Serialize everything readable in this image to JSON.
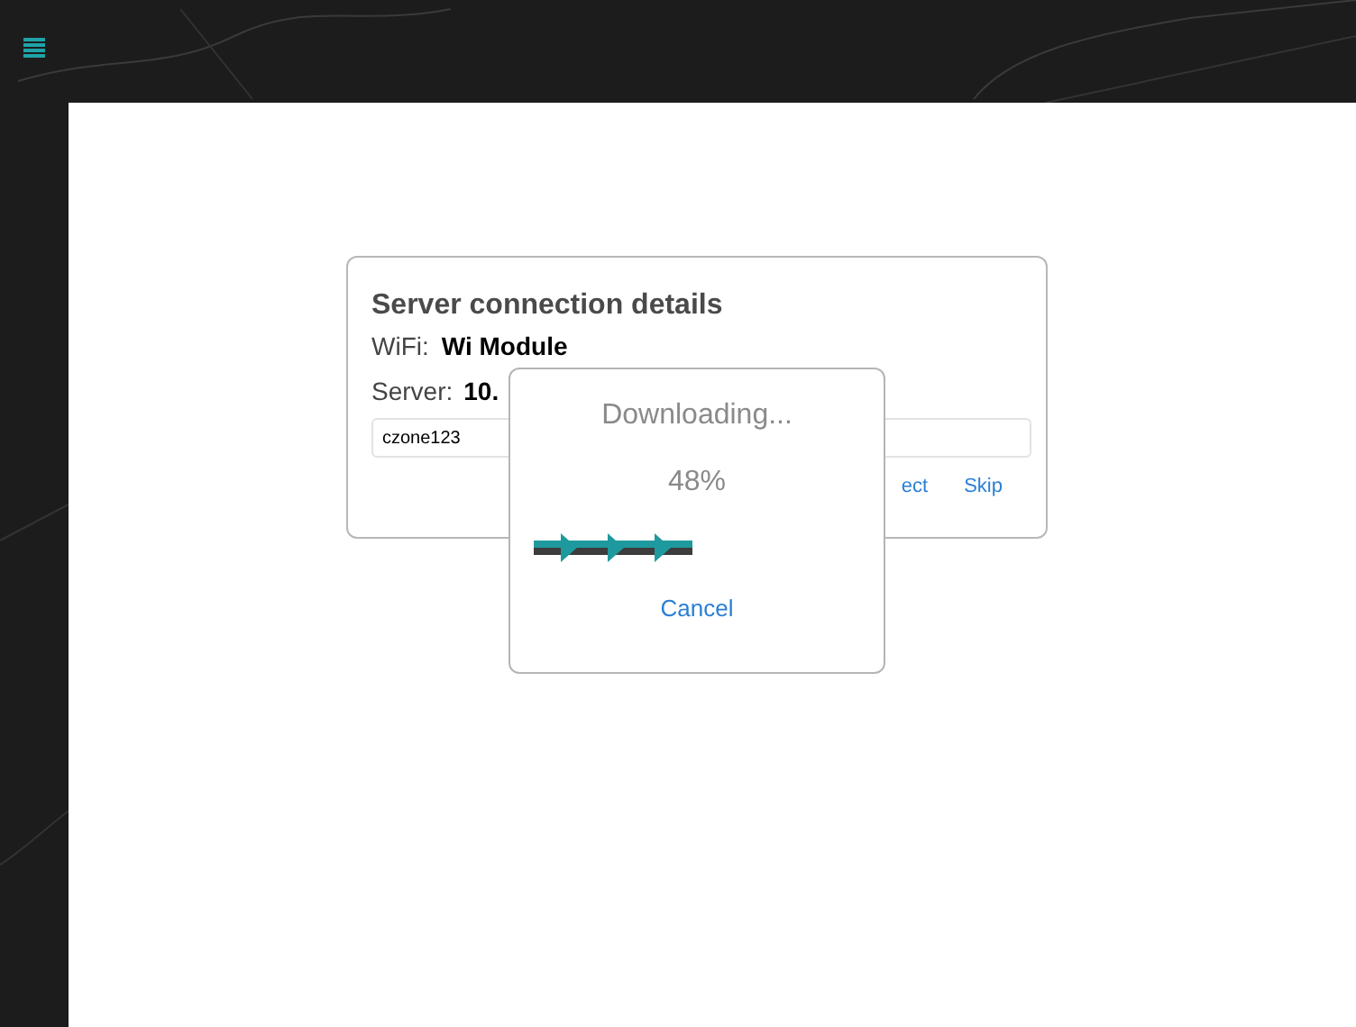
{
  "card": {
    "title": "Server connection details",
    "wifi": {
      "label": "WiFi:",
      "value": "Wi Module"
    },
    "server": {
      "label": "Server:",
      "value": "10."
    },
    "password_field": {
      "value": "czone123"
    },
    "buttons": [
      {
        "label": "ect"
      },
      {
        "label": "Skip"
      }
    ]
  },
  "dialog": {
    "title": "Downloading...",
    "percent": "48%",
    "cancel": "Cancel"
  }
}
